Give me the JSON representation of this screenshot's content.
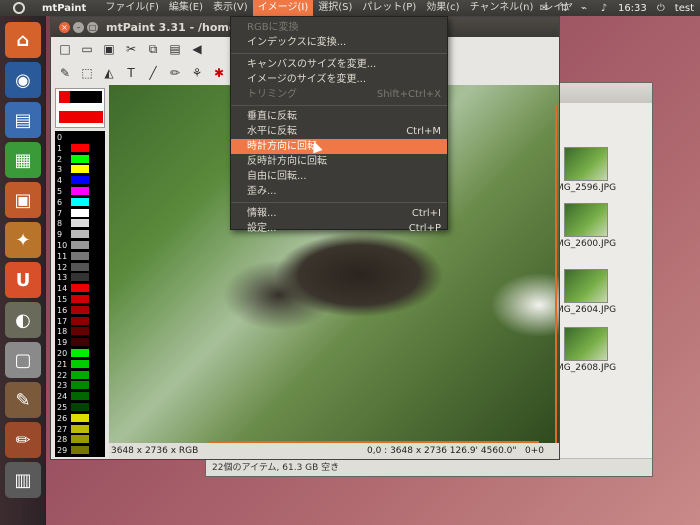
{
  "top_panel": {
    "app_name": "mtPaint",
    "menus": [
      "ファイル(F)",
      "編集(E)",
      "表示(V)",
      "イメージ(I)",
      "選択(S)",
      "パレット(P)",
      "効果(c)",
      "チャンネル(n)",
      "レイヤ"
    ],
    "open_menu_index": 3,
    "clock": "16:33",
    "user": "test",
    "indicators": [
      "mail-icon",
      "updown-icon",
      "network-icon",
      "volume-icon"
    ]
  },
  "launcher": {
    "items": [
      "home-folder-icon",
      "firefox-icon",
      "writer-icon",
      "calc-icon",
      "impress-icon",
      "software-center-icon",
      "ubuntu-one-icon",
      "gimp-icon",
      "camera-icon",
      "paint-brushes-icon",
      "pencils-icon",
      "workspaces-icon"
    ]
  },
  "mtpaint": {
    "title": "mtPaint 3.31 - /home/test/",
    "window_buttons": {
      "close": "×",
      "min": "–",
      "max": "□"
    },
    "palette_numbers": [
      "0",
      "1",
      "2",
      "3",
      "4",
      "5",
      "6",
      "7",
      "8",
      "9",
      "10",
      "11",
      "12",
      "13",
      "14",
      "15",
      "16",
      "17",
      "18",
      "19",
      "20",
      "21",
      "22",
      "23",
      "24",
      "25",
      "26",
      "27",
      "28",
      "29"
    ],
    "palette_colors": [
      "#000000",
      "#ff0000",
      "#00ff00",
      "#ffff00",
      "#0000ff",
      "#ff00ff",
      "#00ffff",
      "#ffffff",
      "#dddddd",
      "#bbbbbb",
      "#999999",
      "#777777",
      "#555555",
      "#333333",
      "#ee0000",
      "#cc0000",
      "#aa0000",
      "#880000",
      "#660000",
      "#440000",
      "#00ee00",
      "#00cc00",
      "#00aa00",
      "#008800",
      "#006600",
      "#004400",
      "#dddd00",
      "#bbbb00",
      "#999900",
      "#777700"
    ],
    "status_left": "3648 x 2736 x RGB",
    "status_right": "0,0 : 3648 x 2736   126.9' 4560.0\"",
    "status_zero": "0+0"
  },
  "image_menu": {
    "items": [
      {
        "label": "RGBに変換",
        "accel": "",
        "disabled": true
      },
      {
        "label": "インデックスに変換...",
        "accel": ""
      },
      {
        "sep": true
      },
      {
        "label": "キャンバスのサイズを変更...",
        "accel": ""
      },
      {
        "label": "イメージのサイズを変更...",
        "accel": ""
      },
      {
        "label": "トリミング",
        "accel": "Shift+Ctrl+X",
        "disabled": true
      },
      {
        "sep": true
      },
      {
        "label": "垂直に反転",
        "accel": ""
      },
      {
        "label": "水平に反転",
        "accel": "Ctrl+M"
      },
      {
        "label": "時計方向に回転",
        "accel": "",
        "highlight": true
      },
      {
        "label": "反時計方向に回転",
        "accel": ""
      },
      {
        "label": "自由に回転...",
        "accel": ""
      },
      {
        "label": "歪み...",
        "accel": ""
      },
      {
        "sep": true
      },
      {
        "label": "情報...",
        "accel": "Ctrl+I"
      },
      {
        "label": "設定...",
        "accel": "Ctrl+P"
      }
    ]
  },
  "file_browser": {
    "thumbnails": [
      "MG_2596.JPG",
      "MG_2600.JPG",
      "MG_2604.JPG",
      "MG_2608.JPG"
    ],
    "status": "22個のアイテム, 61.3 GB 空き"
  }
}
